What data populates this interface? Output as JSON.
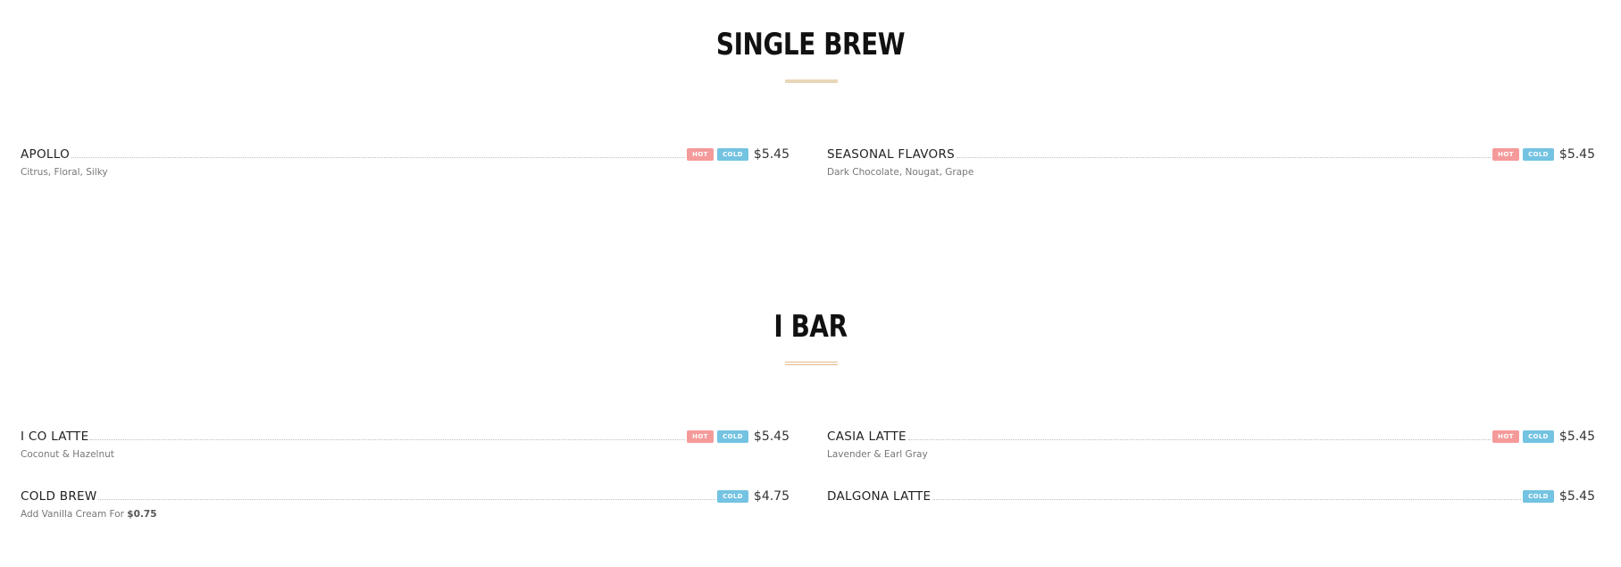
{
  "sections": [
    {
      "title": "SINGLE BREW",
      "items": [
        {
          "name": "APOLLO",
          "desc": "Citrus, Floral, Silky",
          "hot": "HOT",
          "cold": "COLD",
          "price": "$5.45"
        },
        {
          "name": "SEASONAL FLAVORS",
          "desc": "Dark Chocolate, Nougat, Grape",
          "hot": "HOT",
          "cold": "COLD",
          "price": "$5.45"
        }
      ]
    },
    {
      "title": "I BAR",
      "items": [
        {
          "name": "I CO LATTE",
          "desc": "Coconut & Hazelnut",
          "hot": "HOT",
          "cold": "COLD",
          "price": "$5.45"
        },
        {
          "name": "CASIA LATTE",
          "desc": "Lavender & Earl Gray",
          "hot": "HOT",
          "cold": "COLD",
          "price": "$5.45"
        },
        {
          "name": "COLD BREW",
          "desc_prefix": "Add Vanilla Cream For ",
          "desc_strong": "$0.75",
          "cold": "COLD",
          "price": "$4.75"
        },
        {
          "name": "DALGONA LATTE",
          "cold": "COLD",
          "price": "$5.45"
        }
      ]
    }
  ],
  "colors": {
    "hot_badge": "#f59a9a",
    "cold_badge": "#74c3e2",
    "divider": "#e8d6b8"
  }
}
